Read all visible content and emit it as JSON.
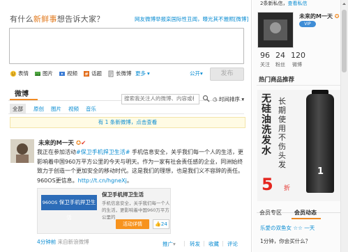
{
  "compose": {
    "prompt_prefix": "有什么",
    "prompt_highlight": "新鲜事",
    "prompt_suffix": "想告诉大家？",
    "hot_topic": "网友微博举报栾国际性丑闻，曝光其不雅照[微博]",
    "input_value": "",
    "tools": [
      {
        "icon": "emoticon-icon",
        "label": "表情"
      },
      {
        "icon": "image-icon",
        "label": "图片"
      },
      {
        "icon": "video-icon",
        "label": "视频"
      },
      {
        "icon": "topic-icon",
        "label": "话题"
      },
      {
        "icon": "longweibo-icon",
        "label": "长微博"
      },
      {
        "icon": "more-icon",
        "label": "更多"
      }
    ],
    "collapse_label": "公开",
    "send_label": "发布"
  },
  "feed": {
    "title": "微博",
    "search_placeholder": "搜索我关注人的微博、内容或标签",
    "sort_label": "时间排序",
    "tabs": [
      "全部",
      "原创",
      "图片",
      "视频",
      "音乐"
    ],
    "new_banner": "有 1 条新微博，点击查看"
  },
  "post": {
    "author": "未来的M一天",
    "body_prefix": "我正在参加活动",
    "body_tag": "#保卫手机捍卫生活#",
    "body_main": " 手机信息安全，关乎我们每一个人的生活，更影响着中国960万平方公里的今天与明天。作为一家有社会责任感的企业，同洲始终致力于创造一个更加安全的移动时代。这是我们的理想，也是我们义不容辞的责任。960OS更信息。",
    "body_link": "http://t.cn/hgneXj",
    "body_end": "。",
    "card": {
      "image_title": "保卫手机捍卫生活",
      "image_sub": "960OS",
      "title": "保卫手机捍卫生活",
      "desc": "手机信息安全，关乎我们每一个人的生活，更影响着中国960万平方公里的",
      "button": "活动详情",
      "count": "24"
    },
    "time": "4分钟前",
    "source": "来自新浪微博",
    "actions": [
      "推广",
      "转发",
      "收藏",
      "评论"
    ]
  },
  "sidebar": {
    "privmsg": "2条新私信，",
    "privmsg_link": "查看私信",
    "name": "未来的M一天",
    "badge": "VIP",
    "stats": [
      {
        "num": "96",
        "label": "关注"
      },
      {
        "num": "24",
        "label": "粉丝"
      },
      {
        "num": "120",
        "label": "微博"
      }
    ],
    "hot_title": "热门商品推荐",
    "ad": {
      "big": "无硅油洗发水",
      "medium": "长期使用不伤头发",
      "price": "5",
      "unit": "折",
      "label": "1"
    },
    "tabs": [
      "会员专区",
      "会员动态"
    ],
    "items": [
      "乐愛の双鱼女 ☆☆ 一天",
      "1分钟，你会买什么？"
    ]
  },
  "colors": {
    "accent": "#f08a24",
    "link": "#0a8cd2",
    "price": "#e4261f"
  }
}
